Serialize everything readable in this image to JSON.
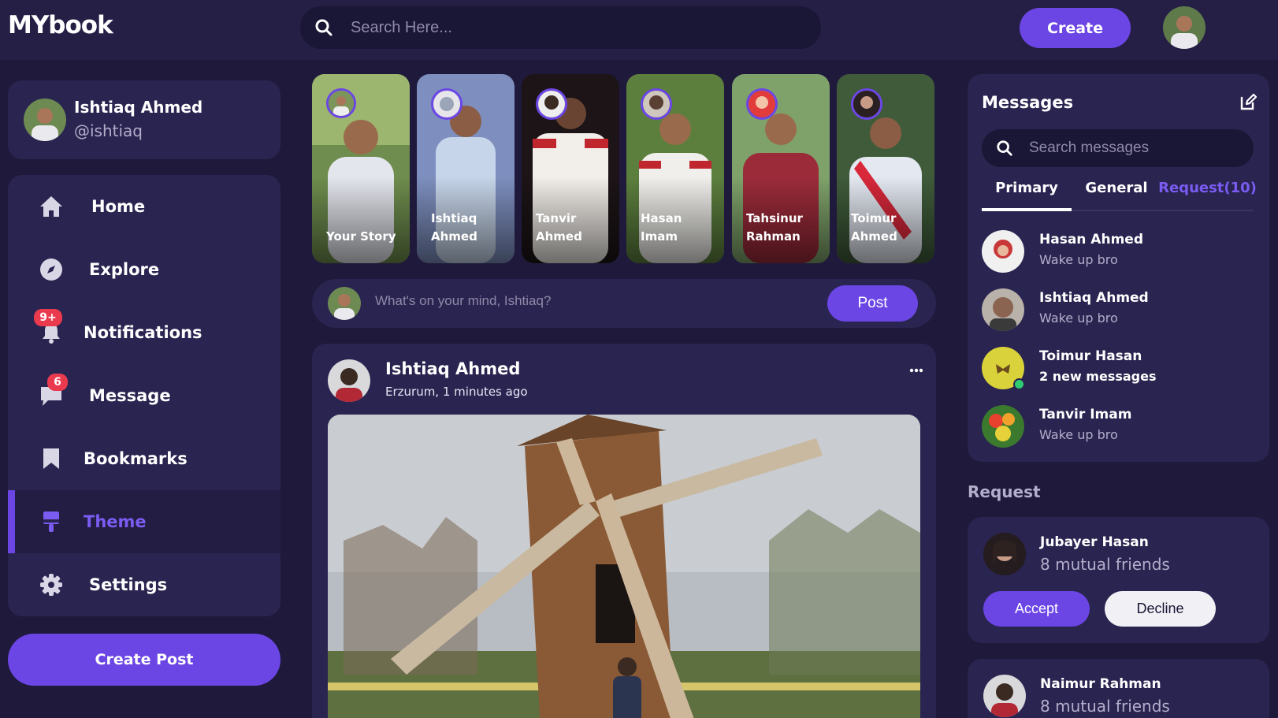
{
  "brand": {
    "logo": "MYbook"
  },
  "navbar": {
    "search_placeholder": "Search Here...",
    "create_label": "Create",
    "icons": {
      "search": "search-icon",
      "avatar": "user-avatar"
    }
  },
  "profile": {
    "name": "Ishtiaq Ahmed",
    "handle": "@ishtiaq"
  },
  "sidebar": {
    "items": [
      {
        "label": "Home",
        "icon": "home-icon",
        "active": false
      },
      {
        "label": "Explore",
        "icon": "compass-icon",
        "active": false
      },
      {
        "label": "Notifications",
        "icon": "bell-icon",
        "badge": "9+",
        "active": false
      },
      {
        "label": "Message",
        "icon": "chat-icon",
        "badge": "6",
        "active": false
      },
      {
        "label": "Bookmarks",
        "icon": "bookmark-icon",
        "active": false
      },
      {
        "label": "Theme",
        "icon": "palette-icon",
        "active": true
      },
      {
        "label": "Settings",
        "icon": "gear-icon",
        "active": false
      }
    ],
    "create_post_label": "Create Post"
  },
  "stories": [
    {
      "name": "Your Story",
      "line1": "Your Story",
      "line2": ""
    },
    {
      "name": "Ishtiaq Ahmed",
      "line1": "Ishtiaq",
      "line2": "Ahmed"
    },
    {
      "name": "Tanvir Ahmed",
      "line1": "Tanvir",
      "line2": "Ahmed"
    },
    {
      "name": "Hasan Imam",
      "line1": "Hasan",
      "line2": "Imam"
    },
    {
      "name": "Tahsinur Rahman",
      "line1": "Tahsinur",
      "line2": "Rahman"
    },
    {
      "name": "Toimur Ahmed",
      "line1": "Toimur",
      "line2": "Ahmed"
    }
  ],
  "composer": {
    "placeholder": "What's on your mind, Ishtiaq?",
    "post_label": "Post"
  },
  "feed": {
    "author": "Ishtiaq Ahmed",
    "meta": "Erzurum, 1 minutes ago",
    "more_icon": "more-horizontal-icon"
  },
  "messages": {
    "title": "Messages",
    "search_placeholder": "Search messages",
    "tabs": {
      "primary": "Primary",
      "general": "General",
      "request": "Request(10)"
    },
    "items": [
      {
        "name": "Hasan Ahmed",
        "text": "Wake up bro",
        "online": false
      },
      {
        "name": "Ishtiaq Ahmed",
        "text": "Wake up bro",
        "online": false
      },
      {
        "name": "Toimur Hasan",
        "text": "2 new messages",
        "online": true
      },
      {
        "name": "Tanvir Imam",
        "text": "Wake up bro",
        "online": false
      }
    ]
  },
  "requests": {
    "heading": "Request",
    "items": [
      {
        "name": "Jubayer Hasan",
        "mutual": "8 mutual friends",
        "accept": "Accept",
        "decline": "Decline"
      },
      {
        "name": "Naimur Rahman",
        "mutual": "8 mutual friends"
      }
    ]
  },
  "colors": {
    "background": "#1f1a3b",
    "navbar": "#251f46",
    "card": "#2a2450",
    "accent": "#6b46e5",
    "badge": "#ea3b4e",
    "online": "#2ecc71"
  }
}
